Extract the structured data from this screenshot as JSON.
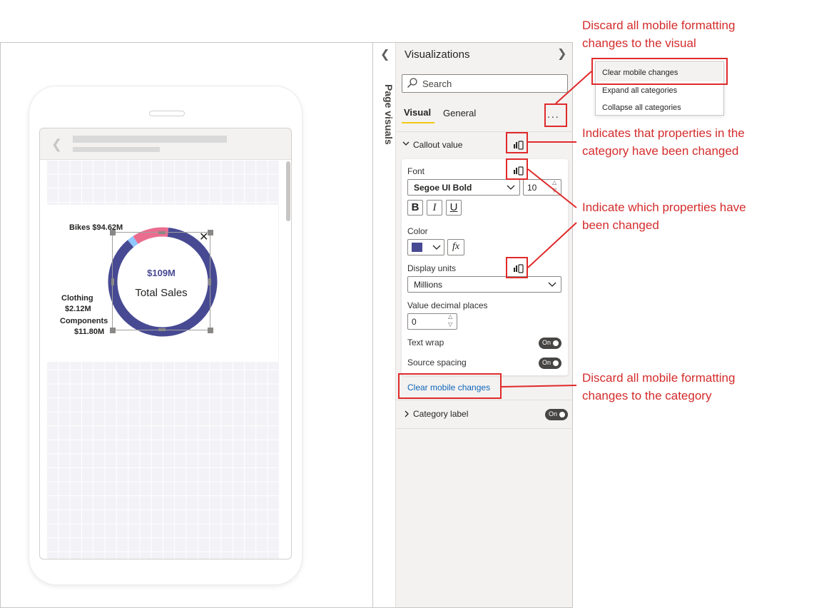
{
  "mobile_visual": {
    "value": "$109M",
    "caption": "Total Sales",
    "segments": [
      {
        "name": "Bikes",
        "label": "Bikes $94.62M",
        "value": 94.62,
        "color": "#474a92"
      },
      {
        "name": "Clothing",
        "label_line1": "Clothing",
        "label_line2": "$2.12M",
        "value": 2.12,
        "color": "#8fc6ff"
      },
      {
        "name": "Components",
        "label_line1": "Components",
        "label_line2": "$11.80M",
        "value": 11.8,
        "color": "#ea6d8f"
      }
    ]
  },
  "page_visuals": {
    "title": "Page visuals"
  },
  "visualizations": {
    "title": "Visualizations",
    "search_placeholder": "Search",
    "tabs": {
      "visual": "Visual",
      "general": "General"
    },
    "more": "...",
    "callout": {
      "title": "Callout value",
      "font_label": "Font",
      "font_value": "Segoe UI Bold",
      "font_size": "10",
      "bold": "B",
      "italic": "I",
      "underline": "U",
      "color_label": "Color",
      "color_value": "#474a92",
      "fx": "fx",
      "display_units_label": "Display units",
      "display_units_value": "Millions",
      "decimal_label": "Value decimal places",
      "decimal_value": "0",
      "text_wrap_label": "Text wrap",
      "text_wrap_state": "On",
      "source_spacing_label": "Source spacing",
      "source_spacing_state": "On"
    },
    "clear_mobile_link": "Clear mobile changes",
    "category_label": {
      "title": "Category label",
      "state": "On"
    }
  },
  "context_menu": {
    "items": [
      "Clear mobile changes",
      "Expand all categories",
      "Collapse all categories"
    ]
  },
  "annotations": {
    "discard_visual_1": "Discard all mobile formatting",
    "discard_visual_2": "changes to the visual",
    "indicates_1": "Indicates that properties in the",
    "indicates_2": "category have been changed",
    "indicate_which_1": "Indicate which properties have",
    "indicate_which_2": "been changed",
    "discard_category_1": "Discard all mobile formatting",
    "discard_category_2": "changes to the category",
    "color": "#e02a2a"
  }
}
